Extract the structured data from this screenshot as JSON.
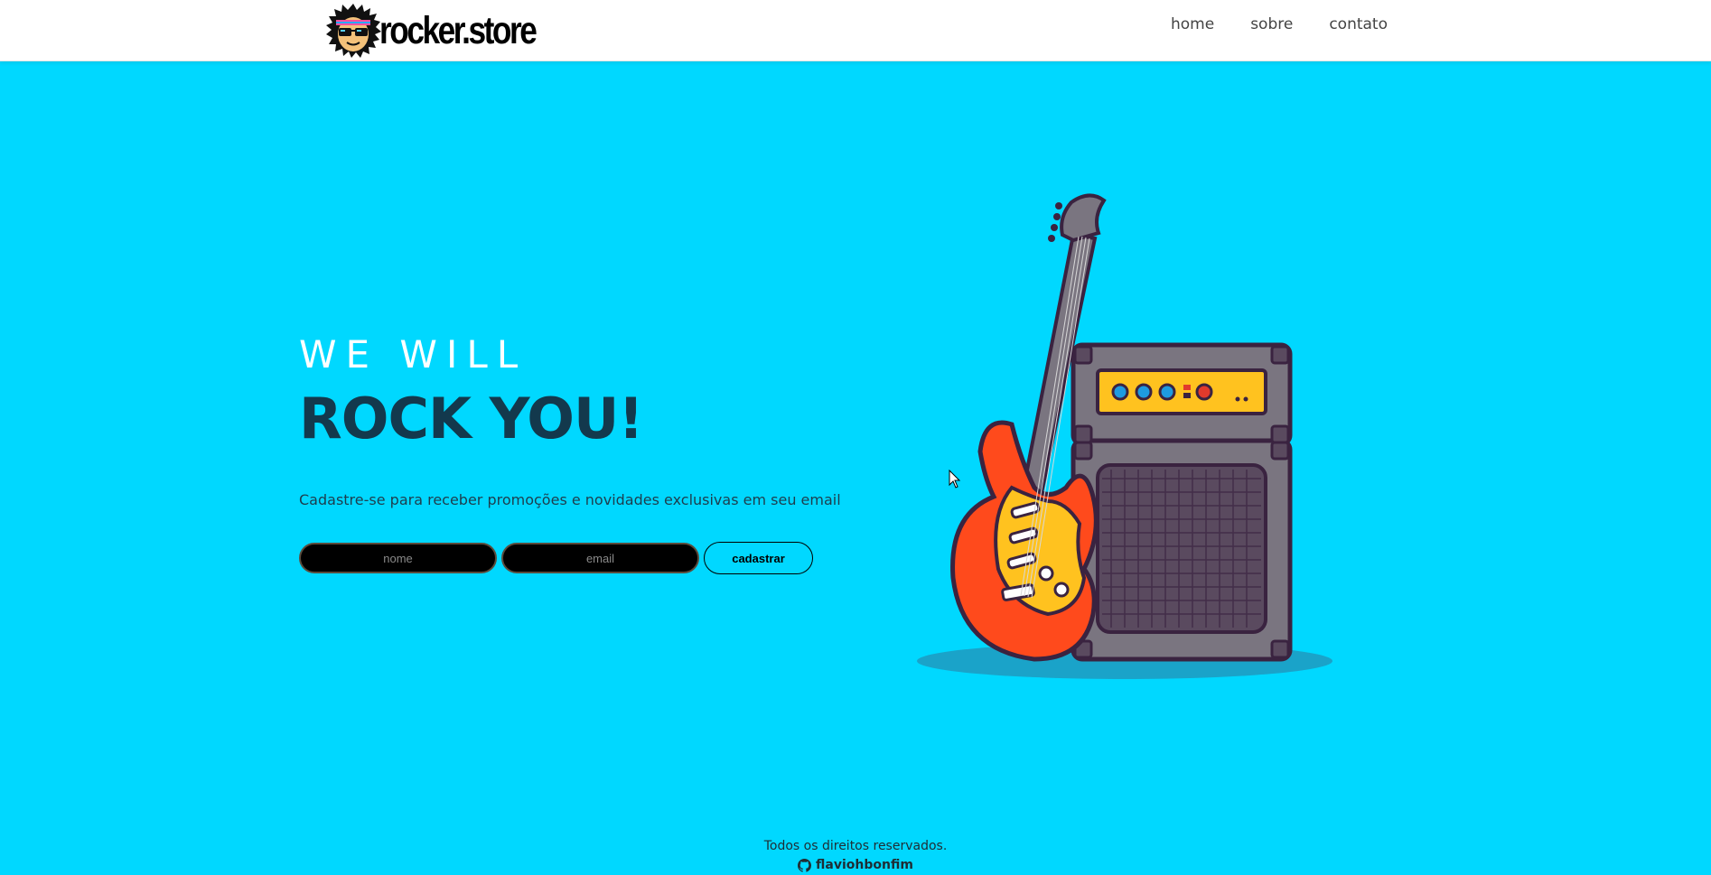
{
  "header": {
    "brand": "rocker.store",
    "logo_icon": "rocker-mascot-icon",
    "nav": [
      {
        "label": "home"
      },
      {
        "label": "sobre"
      },
      {
        "label": "contato"
      }
    ]
  },
  "hero": {
    "title_top": "WE WILL",
    "title_main": "ROCK YOU!",
    "subtitle": "Cadastre-se para receber promoções e novidades exclusivas em seu email",
    "form": {
      "name_placeholder": "nome",
      "email_placeholder": "email",
      "submit_label": "cadastrar"
    },
    "illustration": "guitar-and-amplifier-illustration"
  },
  "footer": {
    "rights": "Todos os direitos reservados.",
    "author": "flaviohbonfim",
    "author_icon": "github-icon"
  },
  "colors": {
    "background": "#00d8ff",
    "title_dark": "#13394d",
    "header_bg": "#ffffff",
    "input_bg": "#000000"
  }
}
